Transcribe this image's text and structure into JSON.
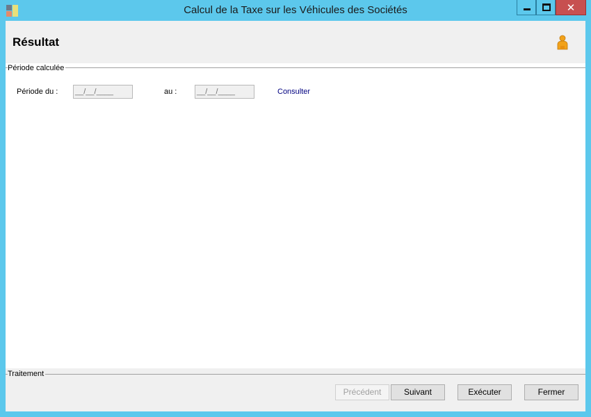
{
  "window": {
    "title": "Calcul de la Taxe sur les Véhicules des Sociétés",
    "controls": {
      "minimize": "minimize-icon",
      "maximize": "maximize-icon",
      "close": "close-icon"
    }
  },
  "header": {
    "title": "Résultat",
    "user_icon": "user-icon"
  },
  "period_group": {
    "label": "Période calculée",
    "from_label": "Période du :",
    "from_value": "__/__/____",
    "to_label": "au :",
    "to_value": "__/__/____",
    "consult_link": "Consulter"
  },
  "footer": {
    "group_label": "Traitement",
    "buttons": {
      "previous": "Précédent",
      "next": "Suivant",
      "execute": "Exécuter",
      "close": "Fermer"
    }
  },
  "colors": {
    "title_bar": "#5cc8ec",
    "close_button": "#c75050",
    "link": "#000080",
    "panel": "#f0f0f0"
  }
}
